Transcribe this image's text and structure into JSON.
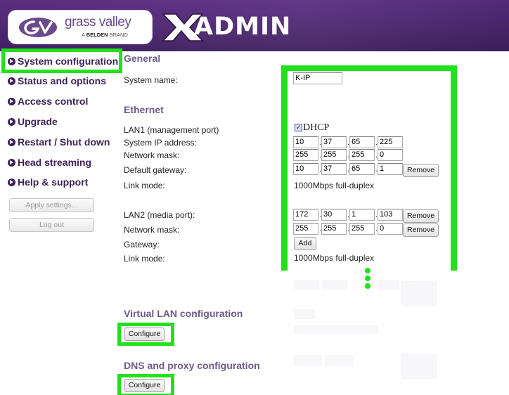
{
  "header": {
    "logo_name": "grass valley",
    "logo_brand_prefix": "A",
    "logo_brand_bold": "BELDEN",
    "logo_brand_suffix": "BRAND",
    "app_name": "ADMIN"
  },
  "sidebar": {
    "items": [
      {
        "label": "System configuration"
      },
      {
        "label": "Status and options"
      },
      {
        "label": "Access control"
      },
      {
        "label": "Upgrade"
      },
      {
        "label": "Restart / Shut down"
      },
      {
        "label": "Head streaming"
      },
      {
        "label": "Help & support"
      }
    ],
    "apply_label": "Apply settings...",
    "logout_label": "Log out"
  },
  "general": {
    "title": "General",
    "system_name_label": "System name:",
    "system_name_value": "K-IP"
  },
  "ethernet": {
    "title": "Ethernet",
    "lan1": {
      "label": "LAN1 (management port)",
      "dhcp_label": "DHCP",
      "dhcp_checked": true,
      "ip_label": "System IP address:",
      "ip": [
        "10",
        "37",
        "65",
        "225"
      ],
      "mask_label": "Network mask:",
      "mask": [
        "255",
        "255",
        "255",
        "0"
      ],
      "gateway_label": "Default gateway:",
      "gateway": [
        "10",
        "37",
        "65",
        "1"
      ],
      "gateway_remove": "Remove",
      "link_label": "Link mode:",
      "link_value": "1000Mbps full-duplex"
    },
    "lan2": {
      "label": "LAN2 (media port):",
      "ip": [
        "172",
        "30",
        "1",
        "103"
      ],
      "ip_remove": "Remove",
      "mask_label": "Network mask:",
      "mask": [
        "255",
        "255",
        "255",
        "0"
      ],
      "mask_remove": "Remove",
      "gateway_label": "Gateway:",
      "gateway_add": "Add",
      "link_label": "Link mode:",
      "link_value": "1000Mbps full-duplex"
    },
    "separator": "."
  },
  "vlan": {
    "title": "Virtual LAN configuration",
    "configure_label": "Configure"
  },
  "dns": {
    "title": "DNS and proxy configuration",
    "configure_label": "Configure"
  },
  "colors": {
    "header": "#4d2770",
    "nav_text": "#3d2357",
    "section_title": "#6f5a8a",
    "highlight": "#22e11c"
  }
}
